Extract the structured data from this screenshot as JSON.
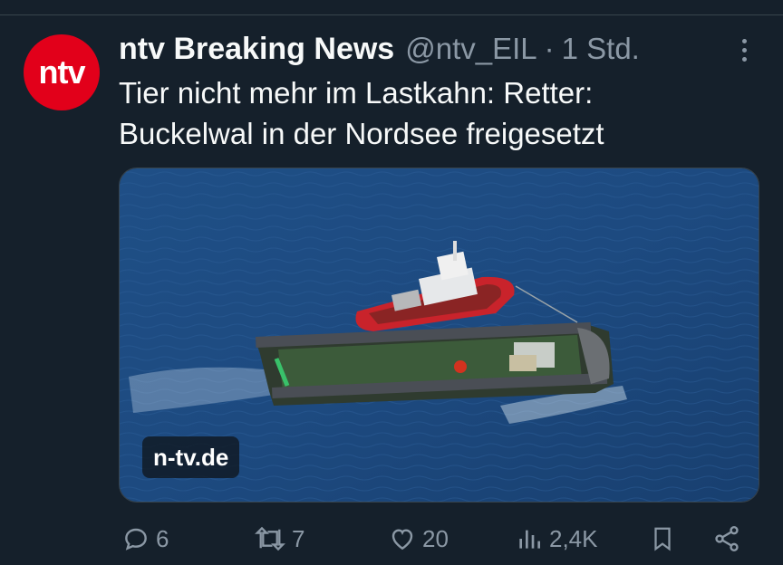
{
  "tweet": {
    "avatar_text": "ntv",
    "author_name": "ntv Breaking News",
    "handle": "@ntv_EIL",
    "separator": "·",
    "time": "1 Std.",
    "text_line1": "Tier nicht mehr im Lastkahn: Retter:",
    "text_line2": "Buckelwal in der Nordsee freigesetzt",
    "media_watermark": "n-tv.de"
  },
  "actions": {
    "replies": "6",
    "retweets": "7",
    "likes": "20",
    "views": "2,4K"
  },
  "colors": {
    "background": "#15202b",
    "avatar_brand": "#e2001a",
    "muted_text": "#8b98a5"
  },
  "icons": [
    "more-icon",
    "reply-icon",
    "retweet-icon",
    "like-icon",
    "views-icon",
    "bookmark-icon",
    "share-icon"
  ]
}
